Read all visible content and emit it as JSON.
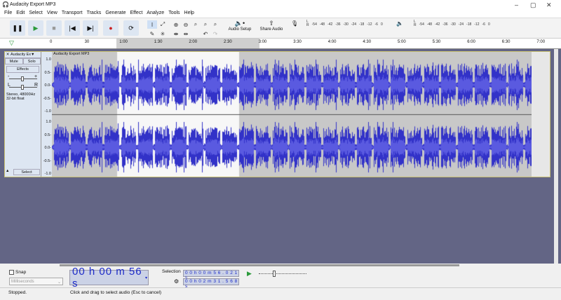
{
  "window": {
    "title": "Audacity Export MP3",
    "minimize": "–",
    "maximize": "▢",
    "close": "✕"
  },
  "menu": [
    "File",
    "Edit",
    "Select",
    "View",
    "Transport",
    "Tracks",
    "Generate",
    "Effect",
    "Analyze",
    "Tools",
    "Help"
  ],
  "toolbar": {
    "audio_setup": "Audio Setup",
    "share_audio": "Share Audio",
    "meter_ticks": [
      "-54",
      "-48",
      "-42",
      "-36",
      "-30",
      "-24",
      "-18",
      "-12",
      "-6",
      "0"
    ]
  },
  "ruler": {
    "ticks": [
      "0",
      "30",
      "1:00",
      "1:30",
      "2:00",
      "2:30",
      "3:00",
      "3:30",
      "4:00",
      "4:30",
      "5:00",
      "5:30",
      "6:00",
      "6:30",
      "7:00"
    ]
  },
  "track": {
    "name": "Audacity Ex▼",
    "mute": "Mute",
    "solo": "Solo",
    "effects": "Effects",
    "gain_minus": "-",
    "gain_plus": "+",
    "pan_l": "L",
    "pan_r": "R",
    "info1": "Stereo, 48000Hz",
    "info2": "32-bit float",
    "select": "Select",
    "clip_name": "Audacity Export MP3",
    "scale": [
      "1.0",
      "0.5-",
      "0.0-",
      "-0.5-",
      "-1.0"
    ]
  },
  "bottom": {
    "snap": "Snap",
    "snap_unit": "Milliseconds",
    "time": "00 h 00 m 56 s",
    "selection_label": "Selection",
    "sel_start": "0 0 h 0 0 m 5 6 . 0 2 1 s",
    "sel_end": "0 0 h 0 2 m 3 1 . 5 6 8 s"
  },
  "status": {
    "state": "Stopped.",
    "hint": "Click and drag to select audio (Esc to cancel)"
  },
  "colors": {
    "waveform": "#3232c8",
    "selection": "#ffffff",
    "background": "#636585"
  }
}
